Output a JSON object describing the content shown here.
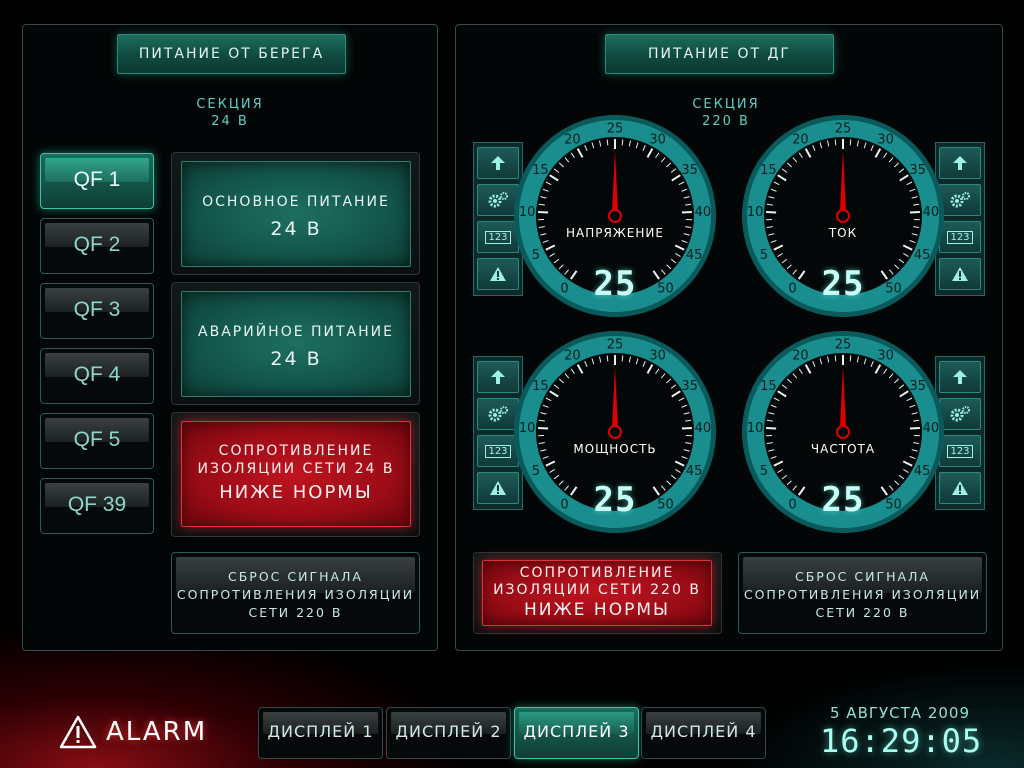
{
  "left_panel": {
    "title": "ПИТАНИЕ ОТ БЕРЕГА",
    "section_label": "СЕКЦИЯ",
    "section_voltage": "24 В",
    "breakers": [
      {
        "label": "QF 1",
        "active": true
      },
      {
        "label": "QF 2",
        "active": false
      },
      {
        "label": "QF 3",
        "active": false
      },
      {
        "label": "QF 4",
        "active": false
      },
      {
        "label": "QF 5",
        "active": false
      },
      {
        "label": "QF 39",
        "active": false
      }
    ],
    "main_power": {
      "line1": "ОСНОВНОЕ ПИТАНИЕ",
      "line2": "24 В"
    },
    "emergency_power": {
      "line1": "АВАРИЙНОЕ ПИТАНИЕ",
      "line2": "24 В"
    },
    "alarm_tile": {
      "line1": "СОПРОТИВЛЕНИЕ",
      "line2": "ИЗОЛЯЦИИ СЕТИ 24 В",
      "line3": "НИЖЕ НОРМЫ"
    },
    "reset_button": {
      "line1": "СБРОС СИГНАЛА",
      "line2": "СОПРОТИВЛЕНИЯ ИЗОЛЯЦИИ",
      "line3": "СЕТИ 220 В"
    }
  },
  "right_panel": {
    "title": "ПИТАНИЕ ОТ ДГ",
    "section_label": "СЕКЦИЯ",
    "section_voltage": "220 В",
    "gauges": [
      {
        "name": "НАПРЯЖЕНИЕ",
        "value": "25",
        "reading": 25
      },
      {
        "name": "ТОК",
        "value": "25",
        "reading": 25
      },
      {
        "name": "МОЩНОСТЬ",
        "value": "25",
        "reading": 25
      },
      {
        "name": "ЧАСТОТА",
        "value": "25",
        "reading": 25
      }
    ],
    "gauge_scale": {
      "min": 0,
      "max": 50,
      "major_ticks": [
        "0",
        "5",
        "10",
        "15",
        "20",
        "25",
        "30",
        "35",
        "40",
        "45",
        "50"
      ]
    },
    "side_buttons": {
      "up": "up-arrow-icon",
      "settings": "gear-icon",
      "numeric": "123",
      "warning": "warning-icon"
    },
    "alarm_tile": {
      "line1": "СОПРОТИВЛЕНИЕ",
      "line2": "ИЗОЛЯЦИИ СЕТИ 220 В",
      "line3": "НИЖЕ НОРМЫ"
    },
    "reset_button": {
      "line1": "СБРОС СИГНАЛА",
      "line2": "СОПРОТИВЛЕНИЯ ИЗОЛЯЦИИ",
      "line3": "СЕТИ 220 В"
    }
  },
  "footer": {
    "alarm_label": "ALARM",
    "displays": [
      {
        "label": "ДИСПЛЕЙ 1",
        "active": false
      },
      {
        "label": "ДИСПЛЕЙ 2",
        "active": false
      },
      {
        "label": "ДИСПЛЕЙ 3",
        "active": true
      },
      {
        "label": "ДИСПЛЕЙ 4",
        "active": false
      }
    ],
    "date": "5 АВГУСТА 2009",
    "time": "16:29:05"
  },
  "colors": {
    "accent": "#1d6d5d",
    "alarm": "#c01420",
    "needle": "#e00000",
    "dial_ring": "#1a8a8a"
  }
}
